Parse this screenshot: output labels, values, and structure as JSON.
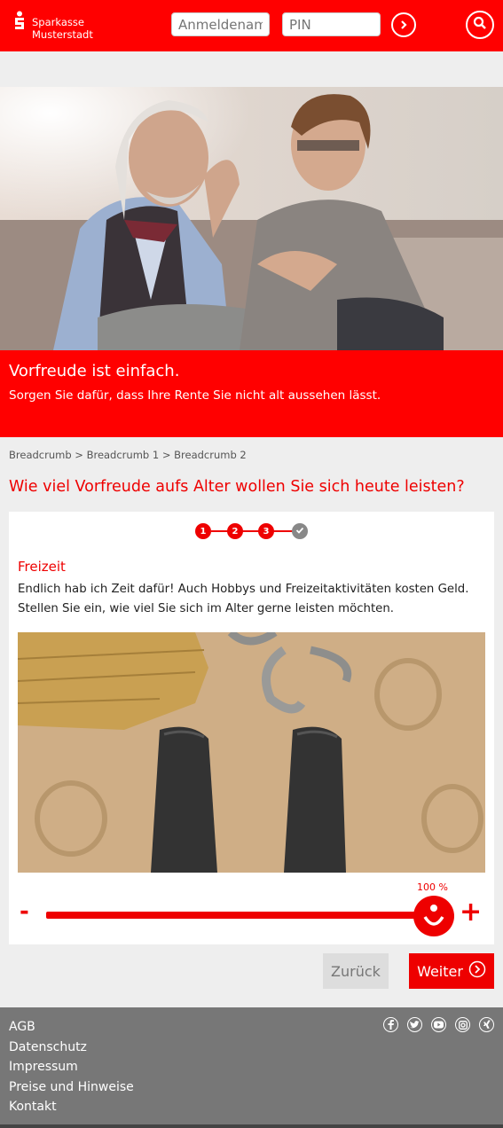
{
  "brand": {
    "line1": "Sparkasse",
    "line2": "Musterstadt",
    "logo_icon": "sparkasse-s-logo"
  },
  "login": {
    "username_placeholder": "Anmeldename",
    "pin_placeholder": "PIN",
    "submit_icon": "chevron-right-icon",
    "search_icon": "search-icon"
  },
  "hero": {
    "title": "Vorfreude ist einfach.",
    "subtitle": "Sorgen Sie dafür, dass Ihre Rente Sie nicht alt aussehen lässt."
  },
  "breadcrumb": "Breadcrumb > Breadcrumb 1 > Breadcrumb 2",
  "question": "Wie viel Vorfreude aufs Alter wollen Sie sich heute leisten?",
  "steps": [
    "1",
    "2",
    "3"
  ],
  "steps_done_icon": "check-icon",
  "section": {
    "title": "Freizeit",
    "text": "Endlich hab ich Zeit dafür! Auch Hobbys und Freizeitaktivitäten kosten Geld. Stellen Sie ein, wie viel Sie sich im Alter gerne leisten möchten."
  },
  "slider": {
    "value_label": "100 %",
    "value_fraction": 1.0,
    "minus": "-",
    "plus": "+"
  },
  "buttons": {
    "back": "Zurück",
    "next": "Weiter"
  },
  "footer": {
    "links": [
      "AGB",
      "Datenschutz",
      "Impressum",
      "Preise und Hinweise",
      "Kontakt"
    ],
    "social_icons": [
      "facebook-icon",
      "twitter-icon",
      "youtube-icon",
      "instagram-icon",
      "xing-icon"
    ]
  },
  "colors": {
    "brand_red": "#ff0000",
    "footer_gray": "#777777"
  }
}
